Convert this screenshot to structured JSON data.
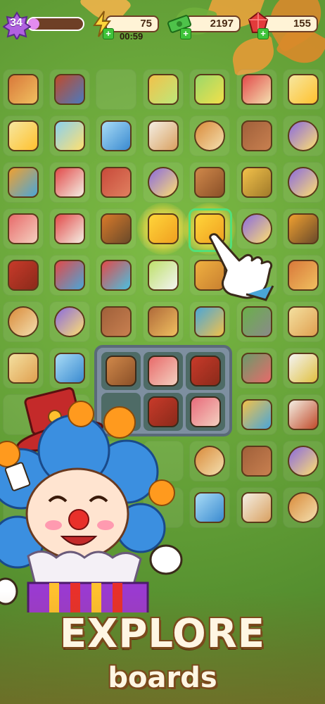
{
  "hud": {
    "level": "34",
    "xp_progress": 0.2,
    "energy": "75",
    "energy_timer": "00:59",
    "cash": "2197",
    "gems": "155",
    "icons": [
      "level-star-icon",
      "energy-bolt-icon",
      "cash-stack-icon",
      "red-gem-icon",
      "plus-icon"
    ]
  },
  "board": {
    "rows": [
      [
        "tent",
        "camper-man",
        "",
        "juice-cup",
        "lantern-jar",
        "picnic-table",
        "bolt-card"
      ],
      [
        "bolt-card",
        "cooler-box",
        "lunch-box",
        "photo-card",
        "compass",
        "basket",
        "bolt-orb"
      ],
      [
        "hot-air-balloon",
        "food-truck",
        "tin-box",
        "bolt-orb",
        "meat-skewer",
        "flashlight",
        "bolt-orb"
      ],
      [
        "bacon-skewer",
        "food-truck",
        "oil-lantern",
        "corn-skewer",
        "corn-skewer",
        "bolt-orb",
        "camp-stove"
      ],
      [
        "sausage-skewer",
        "fire-extinguisher",
        "spray-bottle",
        "knife",
        "hay-bale",
        "",
        "tent"
      ],
      [
        "compass",
        "bolt-orb",
        "basket",
        "stool-chair",
        "treasure-chest",
        "cactus-tools",
        "map-scroll"
      ],
      [
        "map-scroll",
        "lunch-box",
        "",
        "",
        "",
        "tool-kit",
        "scissors"
      ],
      [
        "",
        "",
        "",
        "",
        "",
        "landscape-card",
        "camper-photo"
      ],
      [
        "",
        "",
        "",
        "",
        "compass",
        "basket",
        "bolt-orb"
      ],
      [
        "",
        "",
        "",
        "",
        "lunch-box",
        "photo-card",
        "compass"
      ]
    ]
  },
  "colors": {
    "background": "#6aa63a",
    "accent_bar": "#e48bf0",
    "selection": "#52e07a",
    "title_text": "#fff6e3",
    "title_outline": "#7a4a1c"
  },
  "tray": {
    "items": [
      "drumstick-skewer",
      "bacon-skewer",
      "sausage-skewer",
      "",
      "sausage-skewer",
      "steak"
    ]
  },
  "promo": {
    "title": "EXPLORE",
    "subtitle": "boards"
  }
}
